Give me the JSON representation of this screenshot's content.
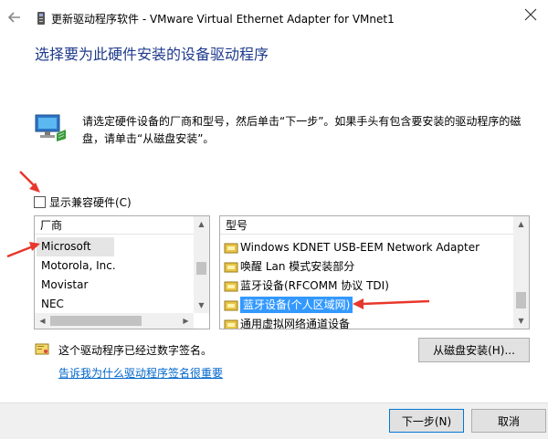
{
  "window": {
    "title": "更新驱动程序软件 - VMware Virtual Ethernet Adapter for VMnet1"
  },
  "page": {
    "heading": "选择要为此硬件安装的设备驱动程序",
    "instructions": "请选定硬件设备的厂商和型号，然后单击“下一步”。如果手头有包含要安装的驱动程序的磁盘，请单击“从磁盘安装”。"
  },
  "compat": {
    "label": "显示兼容硬件(C)",
    "checked": false
  },
  "manufacturers": {
    "header": "厂商",
    "items": [
      "Microsoft",
      "Motorola, Inc.",
      "Movistar",
      "NEC"
    ],
    "selected": "Microsoft"
  },
  "models": {
    "header": "型号",
    "items": [
      "Windows KDNET USB-EEM Network Adapter",
      "唤醒 Lan 模式安装部分",
      "蓝牙设备(RFCOMM 协议 TDI)",
      "蓝牙设备(个人区域网)",
      "通用虚拟网络通道设备"
    ],
    "selected": "蓝牙设备(个人区域网)"
  },
  "signature": {
    "text": "这个驱动程序已经过数字签名。",
    "link": "告诉我为什么驱动程序签名很重要"
  },
  "buttons": {
    "disk": "从磁盘安装(H)...",
    "next": "下一步(N)",
    "cancel": "取消"
  },
  "colors": {
    "accent": "#0078d7",
    "heading": "#1f3b8c",
    "link": "#0066cc",
    "annotation_arrow": "#e8372c"
  },
  "icons": {
    "back": "back-arrow-icon",
    "device": "network-adapter-icon",
    "hardware": "hardware-computer-icon",
    "driver": "driver-package-icon",
    "certificate": "certificate-icon",
    "close": "close-icon"
  }
}
